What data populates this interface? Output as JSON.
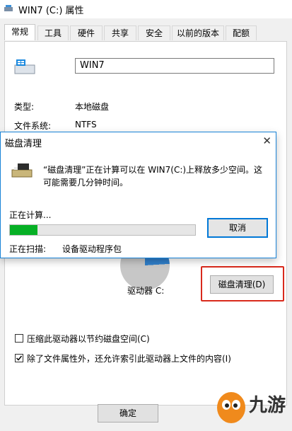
{
  "window": {
    "title": "WIN7 (C:) 属性"
  },
  "tabs": [
    "常规",
    "工具",
    "硬件",
    "共享",
    "安全",
    "以前的版本",
    "配额"
  ],
  "general": {
    "name_value": "WIN7",
    "type_label": "类型:",
    "type_value": "本地磁盘",
    "fs_label": "文件系统:",
    "fs_value": "NTFS",
    "drive_label": "驱动器 C:",
    "cleanup_button": "磁盘清理(D)",
    "compress_label": "压缩此驱动器以节约磁盘空间(C)",
    "index_label": "除了文件属性外，还允许索引此驱动器上文件的内容(I)",
    "compress_checked": false,
    "index_checked": true
  },
  "dialog": {
    "title": "磁盘清理",
    "message": "“磁盘清理”正在计算可以在 WIN7(C:)上释放多少空间。这可能需要几分钟时间。",
    "progress_label": "正在计算...",
    "progress_fraction": 0.15,
    "cancel_label": "取消",
    "scan_label": "正在扫描:",
    "scan_value": "设备驱动程序包"
  },
  "footer": {
    "ok_label": "确定"
  },
  "watermark": {
    "text": "九游"
  },
  "colors": {
    "accent": "#0078d7",
    "progress": "#06b025",
    "highlight": "#d9291c"
  }
}
